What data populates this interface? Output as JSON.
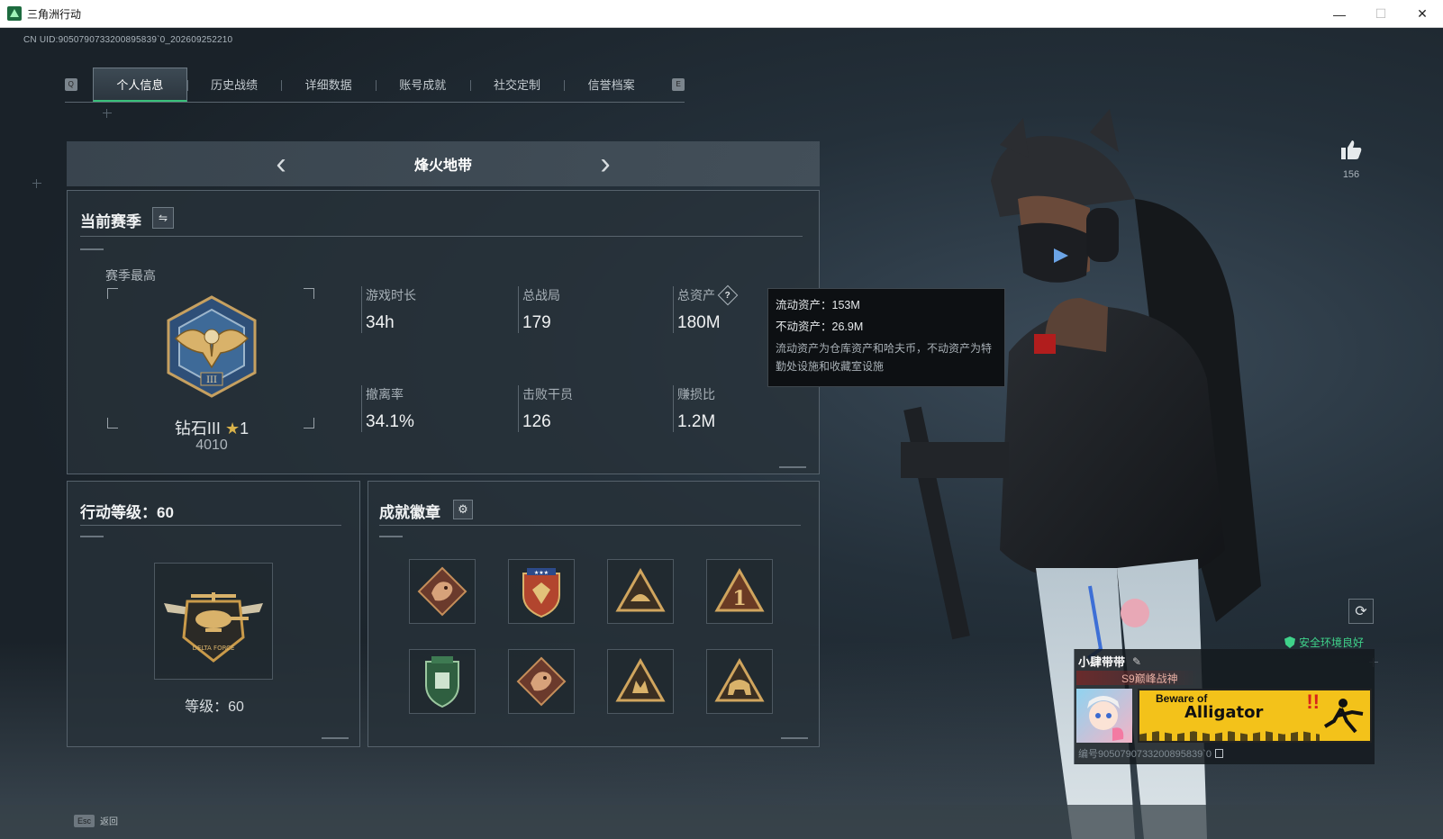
{
  "window": {
    "title": "三角洲行动",
    "minimize": "—",
    "maximize": "☐",
    "close": "✕"
  },
  "uid_line": "CN UID:9050790733200895839`0_202609252210",
  "tabs": {
    "left_key": "Q",
    "right_key": "E",
    "items": [
      {
        "label": "个人信息",
        "active": true
      },
      {
        "label": "历史战绩",
        "active": false
      },
      {
        "label": "详细数据",
        "active": false
      },
      {
        "label": "账号成就",
        "active": false
      },
      {
        "label": "社交定制",
        "active": false
      },
      {
        "label": "信誉档案",
        "active": false
      }
    ]
  },
  "map_selector": {
    "prev": "‹",
    "next": "›",
    "name": "烽火地带"
  },
  "season": {
    "title": "当前赛季",
    "switch_icon": "⇋",
    "best_label": "赛季最高",
    "rank_name": "钻石III",
    "rank_star": "★",
    "rank_star_count": "1",
    "rank_score": "4010",
    "stats": [
      {
        "label": "游戏时长",
        "value": "34h"
      },
      {
        "label": "总战局",
        "value": "179"
      },
      {
        "label": "总资产",
        "value": "180M",
        "help": "?"
      },
      {
        "label": "撤离率",
        "value": "34.1%"
      },
      {
        "label": "击败干员",
        "value": "126"
      },
      {
        "label": "赚损比",
        "value": "1.2M"
      }
    ]
  },
  "tooltip": {
    "liquid": "流动资产：153M",
    "fixed": "不动资产：26.9M",
    "desc": "流动资产为仓库资产和哈夫币，不动资产为特勤处设施和收藏室设施"
  },
  "level": {
    "title": "行动等级：60",
    "label": "等级：60"
  },
  "badges": {
    "title": "成就徽章",
    "gear_icon": "⚙"
  },
  "likes": {
    "count": "156"
  },
  "player": {
    "safe_env": "安全环境良好",
    "name": "小肆带带",
    "edit_icon": "✎",
    "title": "S9巅峰战神",
    "banner_line1": "Beware of",
    "banner_line2": "Alligator",
    "banner_excl": "!!",
    "id_text": "编号9050790733200895839`0"
  },
  "bottom": {
    "esc_key": "Esc",
    "back_label": "返回"
  },
  "colors": {
    "accent_green": "#39c07a",
    "safe_green": "#3fd28a",
    "banner_yellow": "#f3c21a"
  }
}
